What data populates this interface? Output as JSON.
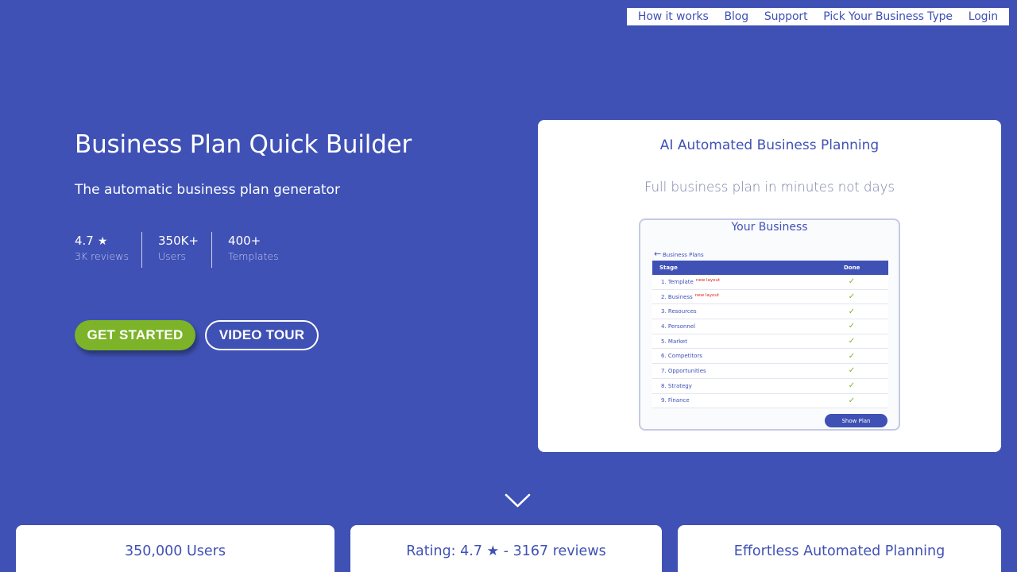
{
  "nav": {
    "items": [
      "How it works",
      "Blog",
      "Support",
      "Pick Your Business Type",
      "Login"
    ]
  },
  "hero": {
    "title": "Business Plan Quick Builder",
    "subtitle": "The automatic business plan generator",
    "stats": [
      {
        "value": "4.7",
        "star": "★",
        "label": "3K reviews"
      },
      {
        "value": "350K+",
        "label": "Users"
      },
      {
        "value": "400+",
        "label": "Templates"
      }
    ],
    "primary_button": "GET STARTED",
    "secondary_button": "VIDEO TOUR"
  },
  "card": {
    "title": "AI Automated Business Planning",
    "subtitle": "Full business plan in minutes not days",
    "preview": {
      "title": "Your Business",
      "back_label": "Business Plans",
      "columns": [
        "Stage",
        "Done"
      ],
      "rows": [
        {
          "stage": "1. Template",
          "note": "new layout"
        },
        {
          "stage": "2. Business",
          "note": "new layout"
        },
        {
          "stage": "3. Resources",
          "note": ""
        },
        {
          "stage": "4. Personnel",
          "note": ""
        },
        {
          "stage": "5. Market",
          "note": ""
        },
        {
          "stage": "6. Competitors",
          "note": ""
        },
        {
          "stage": "7. Opportunities",
          "note": ""
        },
        {
          "stage": "8. Strategy",
          "note": ""
        },
        {
          "stage": "9. Finance",
          "note": ""
        }
      ],
      "button": "Show Plan"
    }
  },
  "bottom_cards": [
    "350,000 Users",
    "Rating: 4.7 ★ - 3167 reviews",
    "Effortless Automated Planning"
  ],
  "colors": {
    "background": "#3f51b5",
    "accent_green": "#7cb329",
    "card": "#ffffff",
    "note_red": "#e02020"
  },
  "icons": {
    "scroll_down": "chevron-down-icon",
    "back": "arrow-left-icon",
    "done": "check-icon",
    "rating": "star-icon"
  }
}
